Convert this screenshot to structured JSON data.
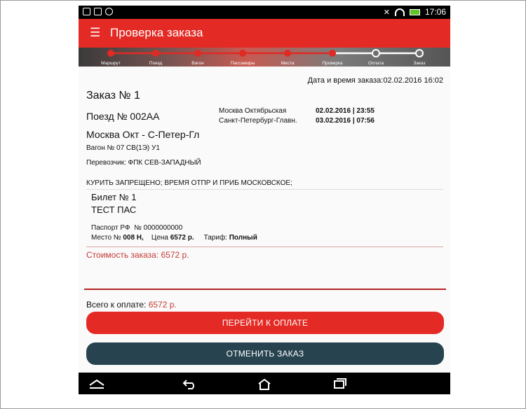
{
  "status_bar": {
    "time": "17:06"
  },
  "app_bar": {
    "title": "Проверка заказа"
  },
  "steps": [
    "Маршрут",
    "Поезд",
    "Вагон",
    "Пассажиры",
    "Места",
    "Проверка",
    "Оплата",
    "Заказ"
  ],
  "order": {
    "datetime": "Дата и время заказа:02.02.2016 16:02",
    "number": "Заказ № 1",
    "train": "Поезд № 002АА",
    "route": "Москва Окт - С-Петер-Гл",
    "car": "Вагон № 07  СВ(1Э) У1",
    "carrier": "Перевозчик: ФПК СЕВ-ЗАПАДНЫЙ",
    "from_station": "Москва Октябрьская",
    "departure": "02.02.2016 | 23:55",
    "to_station": "Санкт-Петербург-Главн.",
    "arrival": "03.02.2016 | 07:56",
    "notice": "КУРИТЬ ЗАПРЕЩЕНО; ВРЕМЯ ОТПР И ПРИБ МОСКОВСКОЕ;"
  },
  "ticket": {
    "title": "Билет № 1",
    "passenger": "ТЕСТ  ПАС",
    "passport_label": "Паспорт РФ",
    "passport_number": "№ 0000000000",
    "seat_label": "Место №",
    "seat_value": "008 Н,",
    "price_label": "Цена",
    "price_value": "6572 р.",
    "tariff_label": "Тариф:",
    "tariff_value": "Полный"
  },
  "cost": "Стоимость заказа: 6572 р.",
  "total": {
    "label": "Всего к оплате:",
    "value": "6572 р."
  },
  "buttons": {
    "pay": "ПЕРЕЙТИ К ОПЛАТЕ",
    "cancel": "ОТМЕНИТЬ ЗАКАЗ"
  },
  "colors": {
    "accent": "#e42a24",
    "cancel": "#274350",
    "cost_text": "#c43c35"
  }
}
